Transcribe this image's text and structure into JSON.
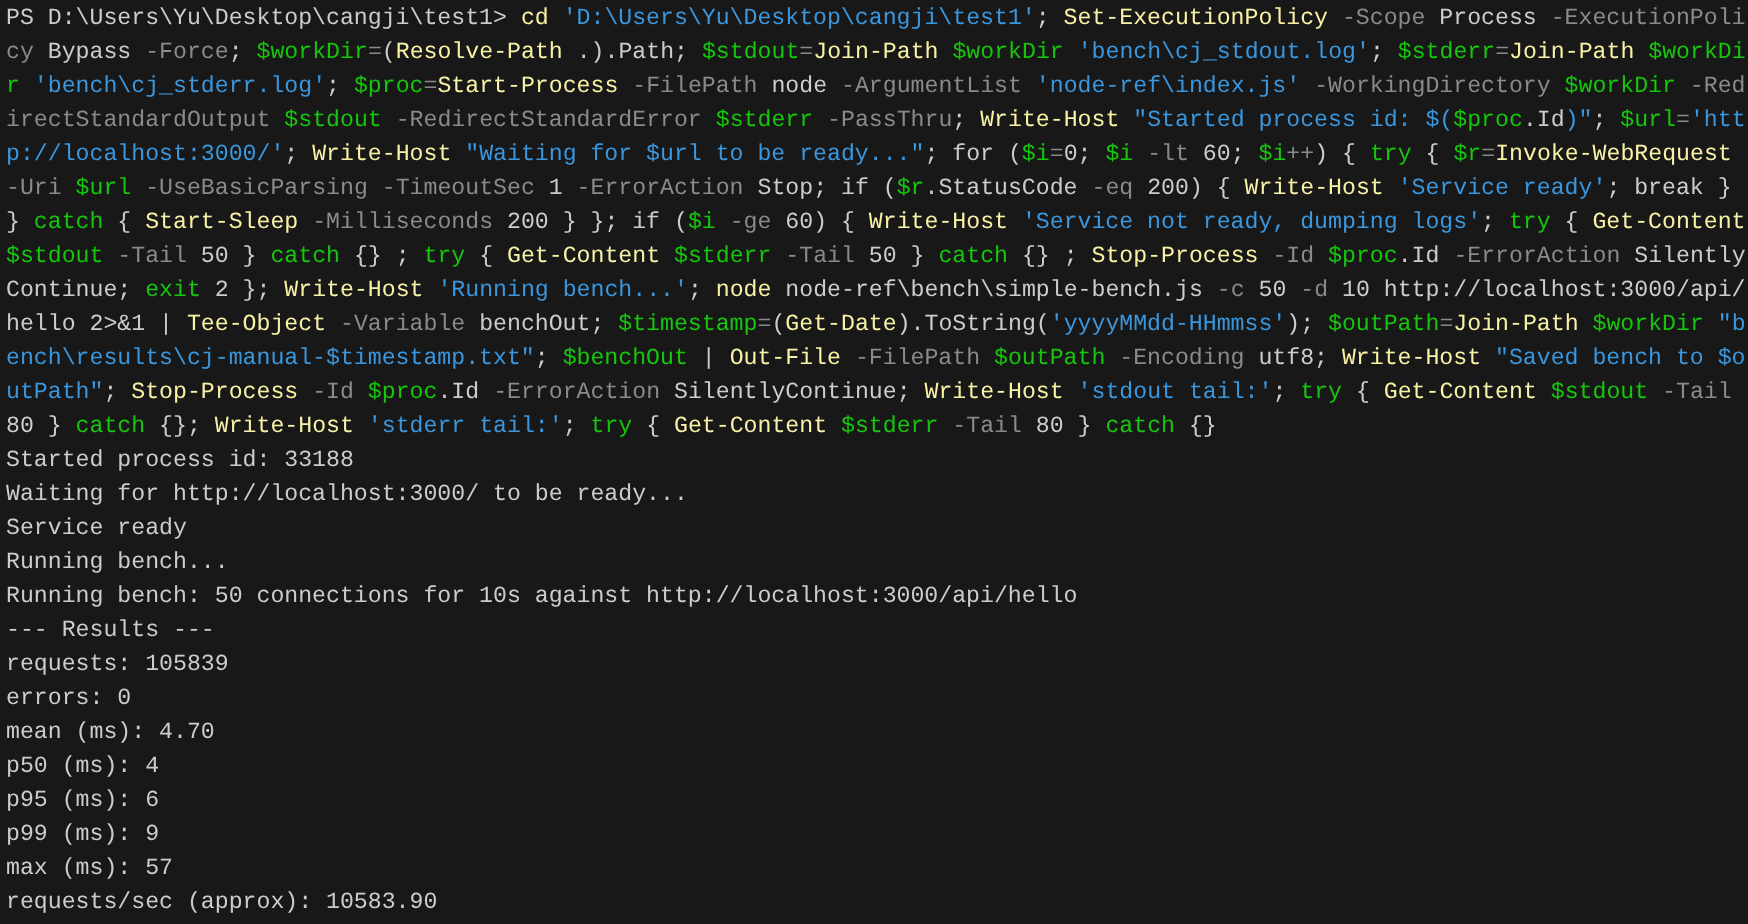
{
  "terminal": {
    "command": [
      {
        "kind": "prompt",
        "text": "PS D:\\Users\\Yu\\Desktop\\cangji\\test1> "
      },
      {
        "kind": "cmdlet",
        "text": "cd"
      },
      {
        "kind": "string",
        "text": " 'D:\\Users\\Yu\\Desktop\\cangji\\test1'"
      },
      {
        "kind": "plain",
        "text": "; "
      },
      {
        "kind": "cmdlet",
        "text": "Set-ExecutionPolicy"
      },
      {
        "kind": "param",
        "text": " -Scope"
      },
      {
        "kind": "plain",
        "text": " Process "
      },
      {
        "kind": "param",
        "text": "-ExecutionPolicy"
      },
      {
        "kind": "plain",
        "text": " Bypass "
      },
      {
        "kind": "param",
        "text": "-Force"
      },
      {
        "kind": "plain",
        "text": "; "
      },
      {
        "kind": "variable",
        "text": "$workDir"
      },
      {
        "kind": "param",
        "text": "="
      },
      {
        "kind": "plain",
        "text": "("
      },
      {
        "kind": "cmdlet",
        "text": "Resolve-Path"
      },
      {
        "kind": "plain",
        "text": " .).Path; "
      },
      {
        "kind": "variable",
        "text": "$stdout"
      },
      {
        "kind": "param",
        "text": "="
      },
      {
        "kind": "cmdlet",
        "text": "Join-Path"
      },
      {
        "kind": "variable",
        "text": " $workDir"
      },
      {
        "kind": "string",
        "text": " 'bench\\cj_stdout.log'"
      },
      {
        "kind": "plain",
        "text": "; "
      },
      {
        "kind": "variable",
        "text": "$stderr"
      },
      {
        "kind": "param",
        "text": "="
      },
      {
        "kind": "cmdlet",
        "text": "Join-Path"
      },
      {
        "kind": "variable",
        "text": " $workDir"
      },
      {
        "kind": "string",
        "text": " 'bench\\cj_stderr.log'"
      },
      {
        "kind": "plain",
        "text": "; "
      },
      {
        "kind": "variable",
        "text": "$proc"
      },
      {
        "kind": "param",
        "text": "="
      },
      {
        "kind": "cmdlet",
        "text": "Start-Process"
      },
      {
        "kind": "param",
        "text": " -FilePath"
      },
      {
        "kind": "plain",
        "text": " node "
      },
      {
        "kind": "param",
        "text": "-ArgumentList"
      },
      {
        "kind": "string",
        "text": " 'node-ref\\index.js'"
      },
      {
        "kind": "param",
        "text": " -WorkingDirectory"
      },
      {
        "kind": "variable",
        "text": " $workDir"
      },
      {
        "kind": "param",
        "text": " -RedirectStandardOutput"
      },
      {
        "kind": "variable",
        "text": " $stdout"
      },
      {
        "kind": "param",
        "text": " -RedirectStandardError"
      },
      {
        "kind": "variable",
        "text": " $stderr"
      },
      {
        "kind": "param",
        "text": " -PassThru"
      },
      {
        "kind": "plain",
        "text": "; "
      },
      {
        "kind": "cmdlet",
        "text": "Write-Host"
      },
      {
        "kind": "string",
        "text": " \"Started process id: $("
      },
      {
        "kind": "variable",
        "text": "$proc"
      },
      {
        "kind": "plain",
        "text": ".Id"
      },
      {
        "kind": "string",
        "text": ")\""
      },
      {
        "kind": "plain",
        "text": "; "
      },
      {
        "kind": "variable",
        "text": "$url"
      },
      {
        "kind": "param",
        "text": "="
      },
      {
        "kind": "string",
        "text": "'http://localhost:3000/'"
      },
      {
        "kind": "plain",
        "text": "; "
      },
      {
        "kind": "cmdlet",
        "text": "Write-Host"
      },
      {
        "kind": "string",
        "text": " \"Waiting for $url to be ready...\""
      },
      {
        "kind": "plain",
        "text": "; for ("
      },
      {
        "kind": "variable",
        "text": "$i"
      },
      {
        "kind": "param",
        "text": "="
      },
      {
        "kind": "plain",
        "text": "0; "
      },
      {
        "kind": "variable",
        "text": "$i"
      },
      {
        "kind": "param",
        "text": " -lt"
      },
      {
        "kind": "plain",
        "text": " 60; "
      },
      {
        "kind": "variable",
        "text": "$i"
      },
      {
        "kind": "param",
        "text": "++"
      },
      {
        "kind": "plain",
        "text": ") { "
      },
      {
        "kind": "keyword",
        "text": "try"
      },
      {
        "kind": "plain",
        "text": " { "
      },
      {
        "kind": "variable",
        "text": "$r"
      },
      {
        "kind": "param",
        "text": "="
      },
      {
        "kind": "cmdlet",
        "text": "Invoke-WebRequest"
      },
      {
        "kind": "param",
        "text": " -Uri"
      },
      {
        "kind": "variable",
        "text": " $url"
      },
      {
        "kind": "param",
        "text": " -UseBasicParsing -TimeoutSec"
      },
      {
        "kind": "plain",
        "text": " 1 "
      },
      {
        "kind": "param",
        "text": "-ErrorAction"
      },
      {
        "kind": "plain",
        "text": " Stop; if ("
      },
      {
        "kind": "variable",
        "text": "$r"
      },
      {
        "kind": "plain",
        "text": ".StatusCode "
      },
      {
        "kind": "param",
        "text": "-eq"
      },
      {
        "kind": "plain",
        "text": " 200) { "
      },
      {
        "kind": "cmdlet",
        "text": "Write-Host"
      },
      {
        "kind": "string",
        "text": " 'Service ready'"
      },
      {
        "kind": "plain",
        "text": "; break } } "
      },
      {
        "kind": "keyword",
        "text": "catch"
      },
      {
        "kind": "plain",
        "text": " { "
      },
      {
        "kind": "cmdlet",
        "text": "Start-Sleep"
      },
      {
        "kind": "param",
        "text": " -Milliseconds"
      },
      {
        "kind": "plain",
        "text": " 200 } }; if ("
      },
      {
        "kind": "variable",
        "text": "$i"
      },
      {
        "kind": "param",
        "text": " -ge"
      },
      {
        "kind": "plain",
        "text": " 60) { "
      },
      {
        "kind": "cmdlet",
        "text": "Write-Host"
      },
      {
        "kind": "string",
        "text": " 'Service not ready, dumping logs'"
      },
      {
        "kind": "plain",
        "text": "; "
      },
      {
        "kind": "keyword",
        "text": "try"
      },
      {
        "kind": "plain",
        "text": " { "
      },
      {
        "kind": "cmdlet",
        "text": "Get-Content"
      },
      {
        "kind": "variable",
        "text": " $stdout"
      },
      {
        "kind": "param",
        "text": " -Tail"
      },
      {
        "kind": "plain",
        "text": " 50 } "
      },
      {
        "kind": "keyword",
        "text": "catch"
      },
      {
        "kind": "plain",
        "text": " {} ; "
      },
      {
        "kind": "keyword",
        "text": "try"
      },
      {
        "kind": "plain",
        "text": " { "
      },
      {
        "kind": "cmdlet",
        "text": "Get-Content"
      },
      {
        "kind": "variable",
        "text": " $stderr"
      },
      {
        "kind": "param",
        "text": " -Tail"
      },
      {
        "kind": "plain",
        "text": " 50 } "
      },
      {
        "kind": "keyword",
        "text": "catch"
      },
      {
        "kind": "plain",
        "text": " {} ; "
      },
      {
        "kind": "cmdlet",
        "text": "Stop-Process"
      },
      {
        "kind": "param",
        "text": " -Id"
      },
      {
        "kind": "variable",
        "text": " $proc"
      },
      {
        "kind": "plain",
        "text": ".Id "
      },
      {
        "kind": "param",
        "text": "-ErrorAction"
      },
      {
        "kind": "plain",
        "text": " SilentlyContinue; "
      },
      {
        "kind": "keyword",
        "text": "exit"
      },
      {
        "kind": "plain",
        "text": " 2 }; "
      },
      {
        "kind": "cmdlet",
        "text": "Write-Host"
      },
      {
        "kind": "string",
        "text": " 'Running bench...'"
      },
      {
        "kind": "plain",
        "text": "; "
      },
      {
        "kind": "cmdlet",
        "text": "node"
      },
      {
        "kind": "plain",
        "text": " node-ref\\bench\\simple-bench.js "
      },
      {
        "kind": "param",
        "text": "-c"
      },
      {
        "kind": "plain",
        "text": " 50 "
      },
      {
        "kind": "param",
        "text": "-d"
      },
      {
        "kind": "plain",
        "text": " 10 http://localhost:3000/api/hello 2>&1 | "
      },
      {
        "kind": "cmdlet",
        "text": "Tee-Object"
      },
      {
        "kind": "param",
        "text": " -Variable"
      },
      {
        "kind": "plain",
        "text": " benchOut; "
      },
      {
        "kind": "variable",
        "text": "$timestamp"
      },
      {
        "kind": "param",
        "text": "="
      },
      {
        "kind": "plain",
        "text": "("
      },
      {
        "kind": "cmdlet",
        "text": "Get-Date"
      },
      {
        "kind": "plain",
        "text": ").ToString("
      },
      {
        "kind": "string",
        "text": "'yyyyMMdd-HHmmss'"
      },
      {
        "kind": "plain",
        "text": "); "
      },
      {
        "kind": "variable",
        "text": "$outPath"
      },
      {
        "kind": "param",
        "text": "="
      },
      {
        "kind": "cmdlet",
        "text": "Join-Path"
      },
      {
        "kind": "variable",
        "text": " $workDir"
      },
      {
        "kind": "string",
        "text": " \"bench\\results\\cj-manual-$timestamp.txt\""
      },
      {
        "kind": "plain",
        "text": "; "
      },
      {
        "kind": "variable",
        "text": "$benchOut"
      },
      {
        "kind": "plain",
        "text": " | "
      },
      {
        "kind": "cmdlet",
        "text": "Out-File"
      },
      {
        "kind": "param",
        "text": " -FilePath"
      },
      {
        "kind": "variable",
        "text": " $outPath"
      },
      {
        "kind": "param",
        "text": " -Encoding"
      },
      {
        "kind": "plain",
        "text": " utf8; "
      },
      {
        "kind": "cmdlet",
        "text": "Write-Host"
      },
      {
        "kind": "string",
        "text": " \"Saved bench to $outPath\""
      },
      {
        "kind": "plain",
        "text": "; "
      },
      {
        "kind": "cmdlet",
        "text": "Stop-Process"
      },
      {
        "kind": "param",
        "text": " -Id"
      },
      {
        "kind": "variable",
        "text": " $proc"
      },
      {
        "kind": "plain",
        "text": ".Id "
      },
      {
        "kind": "param",
        "text": "-ErrorAction"
      },
      {
        "kind": "plain",
        "text": " SilentlyContinue; "
      },
      {
        "kind": "cmdlet",
        "text": "Write-Host"
      },
      {
        "kind": "string",
        "text": " 'stdout tail:'"
      },
      {
        "kind": "plain",
        "text": "; "
      },
      {
        "kind": "keyword",
        "text": "try"
      },
      {
        "kind": "plain",
        "text": " { "
      },
      {
        "kind": "cmdlet",
        "text": "Get-Content"
      },
      {
        "kind": "variable",
        "text": " $stdout"
      },
      {
        "kind": "param",
        "text": " -Tail"
      },
      {
        "kind": "plain",
        "text": " 80 } "
      },
      {
        "kind": "keyword",
        "text": "catch"
      },
      {
        "kind": "plain",
        "text": " {}; "
      },
      {
        "kind": "cmdlet",
        "text": "Write-Host"
      },
      {
        "kind": "string",
        "text": " 'stderr tail:'"
      },
      {
        "kind": "plain",
        "text": "; "
      },
      {
        "kind": "keyword",
        "text": "try"
      },
      {
        "kind": "plain",
        "text": " { "
      },
      {
        "kind": "cmdlet",
        "text": "Get-Content"
      },
      {
        "kind": "variable",
        "text": " $stderr"
      },
      {
        "kind": "param",
        "text": " -Tail"
      },
      {
        "kind": "plain",
        "text": " 80 } "
      },
      {
        "kind": "keyword",
        "text": "catch"
      },
      {
        "kind": "plain",
        "text": " {}"
      }
    ],
    "output": [
      "Started process id: 33188",
      "Waiting for http://localhost:3000/ to be ready...",
      "Service ready",
      "Running bench...",
      "Running bench: 50 connections for 10s against http://localhost:3000/api/hello",
      "--- Results ---",
      "requests: 105839",
      "errors: 0",
      "mean (ms): 4.70",
      "p50 (ms): 4",
      "p95 (ms): 6",
      "p99 (ms): 9",
      "max (ms): 57",
      "requests/sec (approx): 10583.90"
    ]
  }
}
